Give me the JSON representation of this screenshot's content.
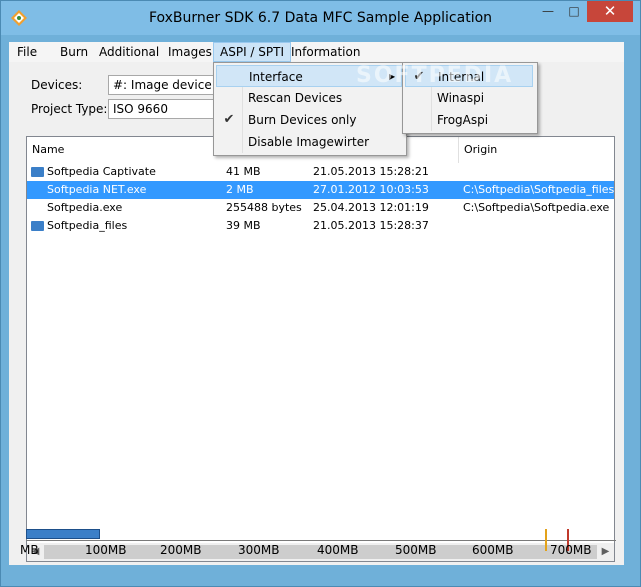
{
  "window": {
    "title": "FoxBurner SDK 6.7 Data MFC Sample Application",
    "close_glyph": "✕",
    "max_glyph": "□",
    "min_glyph": "—"
  },
  "menubar": {
    "items": [
      "File",
      "Burn",
      "Additional",
      "Images",
      "ASPI / SPTI",
      "Information"
    ]
  },
  "form": {
    "devices_label": "Devices:",
    "devices_value": "#: Image device",
    "project_type_label": "Project Type:",
    "project_type_value": "ISO 9660"
  },
  "filelist": {
    "columns": [
      "Name",
      "Origin"
    ],
    "rows": [
      {
        "name": "Softpedia Captivate",
        "size": "41 MB",
        "date": "21.05.2013 15:28:21",
        "origin": "",
        "type": "folder"
      },
      {
        "name": "Softpedia NET.exe",
        "size": "2 MB",
        "date": "27.01.2012 10:03:53",
        "origin": "C:\\Softpedia\\Softpedia_files",
        "type": "file",
        "selected": true
      },
      {
        "name": "Softpedia.exe",
        "size": "255488 bytes",
        "date": "25.04.2013 12:01:19",
        "origin": "C:\\Softpedia\\Softpedia.exe",
        "type": "file"
      },
      {
        "name": "Softpedia_files",
        "size": "39 MB",
        "date": "21.05.2013 15:28:37",
        "origin": "",
        "type": "folder"
      }
    ],
    "scroll_left": "◀",
    "scroll_right": "▶"
  },
  "capacity": {
    "scale_labels": [
      "MB",
      "100MB",
      "200MB",
      "300MB",
      "400MB",
      "500MB",
      "600MB",
      "700MB"
    ],
    "used_fraction": 0.122,
    "marker_colors": {
      "warn": "#e3a21a",
      "limit": "#c0392b"
    }
  },
  "aspi_menu": {
    "items": [
      {
        "label": "Interface",
        "has_submenu": true,
        "checked": false,
        "hover": true
      },
      {
        "label": "Rescan Devices",
        "checked": false
      },
      {
        "label": "Burn Devices only",
        "checked": true
      },
      {
        "label": "Disable Imagewirter",
        "checked": false
      }
    ],
    "submenu_arrow": "▶"
  },
  "interface_submenu": {
    "items": [
      {
        "label": "Internal",
        "checked": true,
        "hover": true
      },
      {
        "label": "Winaspi",
        "checked": false
      },
      {
        "label": "FrogAspi",
        "checked": false
      }
    ]
  },
  "watermark": "SOFTPEDIA",
  "checkmark": "✔"
}
